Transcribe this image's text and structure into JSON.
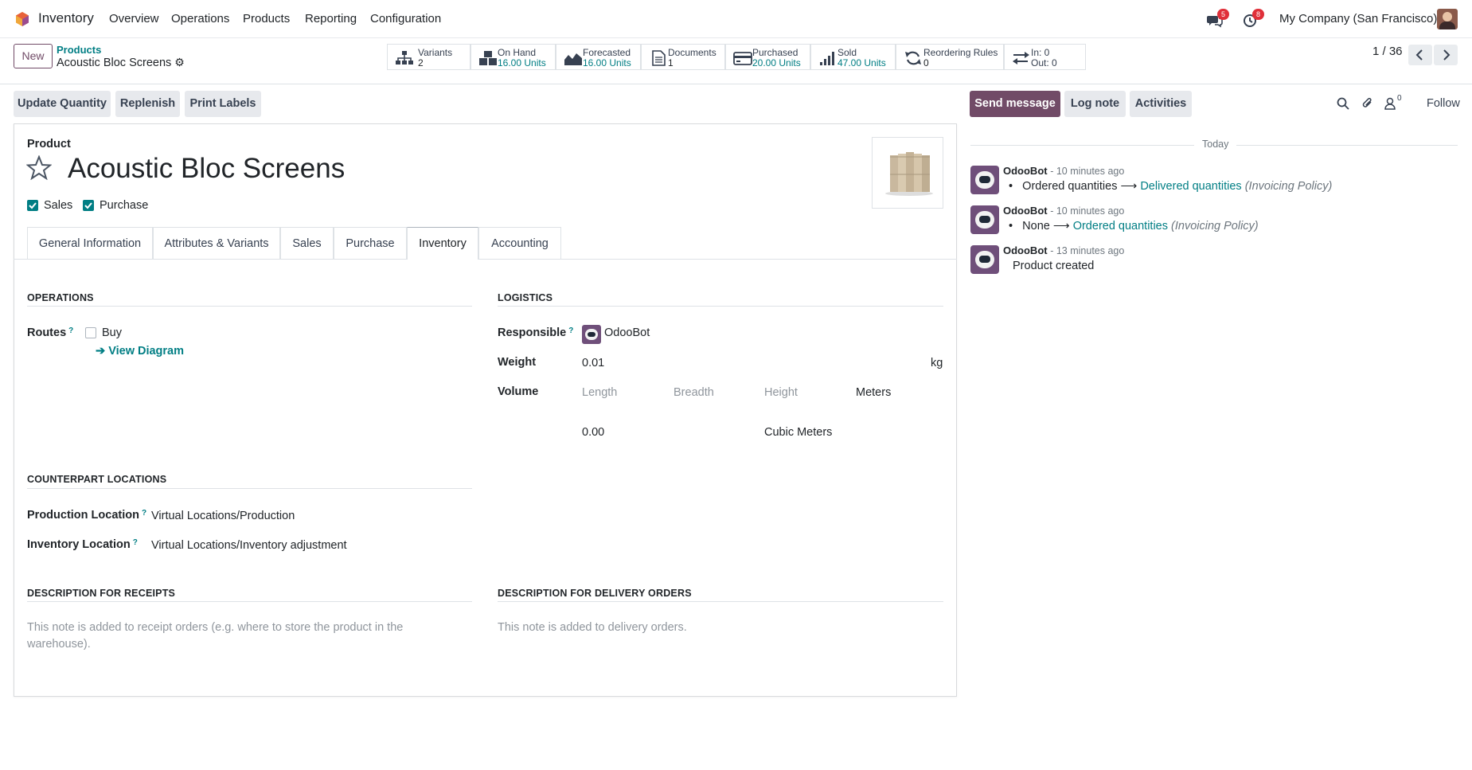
{
  "navbar": {
    "app_name": "Inventory",
    "menus": [
      "Overview",
      "Operations",
      "Products",
      "Reporting",
      "Configuration"
    ],
    "messages_count": "5",
    "activities_count": "8",
    "company": "My Company (San Francisco)"
  },
  "control_panel": {
    "new_label": "New",
    "breadcrumb_parent": "Products",
    "breadcrumb_current": "Acoustic Bloc Screens",
    "stats": [
      {
        "label": "Variants",
        "value": "2"
      },
      {
        "label": "On Hand",
        "value": "16.00 Units"
      },
      {
        "label": "Forecasted",
        "value": "16.00 Units"
      },
      {
        "label": "Documents",
        "value": "1"
      },
      {
        "label": "Purchased",
        "value": "20.00 Units"
      },
      {
        "label": "Sold",
        "value": "47.00 Units"
      },
      {
        "label": "Reordering Rules",
        "value": "0"
      },
      {
        "label": "In: 0",
        "value": "Out: 0"
      }
    ],
    "pager": "1 / 36"
  },
  "actions": {
    "update_quantity": "Update Quantity",
    "replenish": "Replenish",
    "print_labels": "Print Labels"
  },
  "chatter": {
    "send_message": "Send message",
    "log_note": "Log note",
    "activities": "Activities",
    "followers_count": "0",
    "follow": "Follow",
    "date_separator": "Today",
    "messages": [
      {
        "author": "OdooBot",
        "time": "- 10 minutes ago",
        "from": "Ordered quantities",
        "to": "Delivered quantities",
        "field": "(Invoicing Policy)"
      },
      {
        "author": "OdooBot",
        "time": "- 10 minutes ago",
        "from": "None",
        "to": "Ordered quantities",
        "field": "(Invoicing Policy)"
      },
      {
        "author": "OdooBot",
        "time": "- 13 minutes ago",
        "text": "Product created"
      }
    ]
  },
  "form": {
    "product_label": "Product",
    "product_name": "Acoustic Bloc Screens",
    "sales_label": "Sales",
    "purchase_label": "Purchase",
    "sales_checked": true,
    "purchase_checked": true,
    "tabs": [
      "General Information",
      "Attributes & Variants",
      "Sales",
      "Purchase",
      "Inventory",
      "Accounting"
    ],
    "active_tab": "Inventory",
    "operations": {
      "title": "OPERATIONS",
      "routes_label": "Routes",
      "help": "?",
      "route_buy": "Buy",
      "view_diagram": "View Diagram"
    },
    "logistics": {
      "title": "LOGISTICS",
      "responsible_label": "Responsible",
      "responsible_value": "OdooBot",
      "weight_label": "Weight",
      "weight_value": "0.01",
      "weight_unit": "kg",
      "volume_label": "Volume",
      "length_ph": "Length",
      "breadth_ph": "Breadth",
      "height_ph": "Height",
      "dim_unit": "Meters",
      "volume_value": "0.00",
      "volume_unit": "Cubic Meters"
    },
    "counterpart": {
      "title": "COUNTERPART LOCATIONS",
      "production_label": "Production Location",
      "production_value": "Virtual Locations/Production",
      "inventory_label": "Inventory Location",
      "inventory_value": "Virtual Locations/Inventory adjustment"
    },
    "receipts": {
      "title": "DESCRIPTION FOR RECEIPTS",
      "placeholder_line1": "This note is added to receipt orders (e.g. where to store the product in the",
      "placeholder_line2": "warehouse)."
    },
    "delivery": {
      "title": "DESCRIPTION FOR DELIVERY ORDERS",
      "placeholder": "This note is added to delivery orders."
    }
  },
  "colors": {
    "brand": "#714b67",
    "link": "#017e84",
    "badge": "#e0303a"
  }
}
